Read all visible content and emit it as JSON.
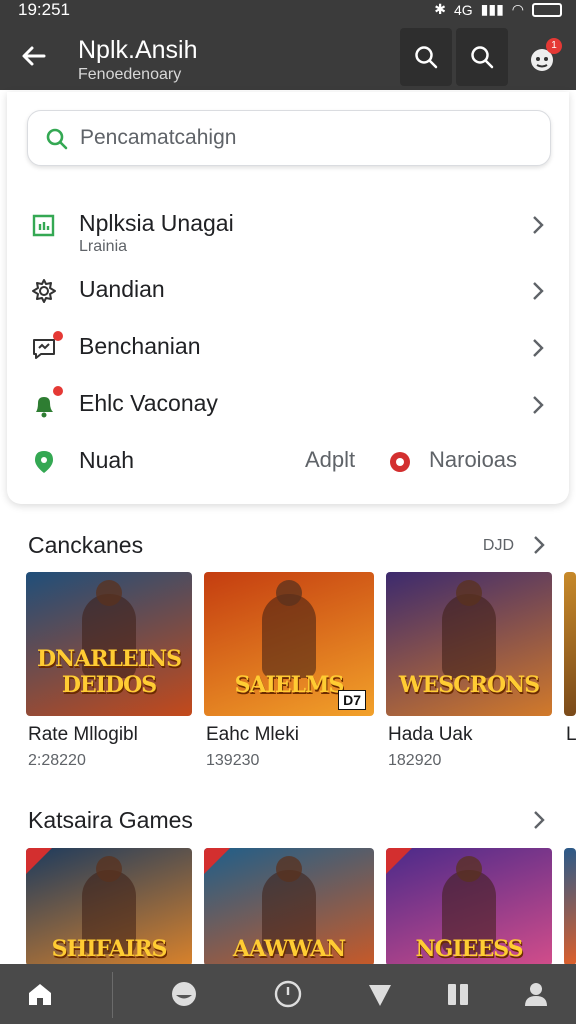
{
  "status_bar": {
    "time": "19:251",
    "net": "4G"
  },
  "app_bar": {
    "title": "Nplk.Ansih",
    "subtitle": "Fenoedenoary"
  },
  "search": {
    "placeholder": "Pencamatcahign"
  },
  "menu": {
    "items": [
      {
        "label": "Nplksia Unagai",
        "sub": "Lrainia"
      },
      {
        "label": "Uandian"
      },
      {
        "label": "Benchanian"
      },
      {
        "label": "Ehlc Vaconay"
      },
      {
        "label": "Nuah",
        "right_text_1": "Adplt",
        "right_text_2": "Naroioas"
      }
    ]
  },
  "section1": {
    "title": "Canckanes",
    "more": "DJD",
    "games": [
      {
        "name": "Rate Mllogibl",
        "count": "2:28220",
        "art": "DNARLEINS DEIDOS",
        "colors": [
          "#1f4e7a",
          "#c44a1b"
        ]
      },
      {
        "name": "Eahc Mleki",
        "count": "139230",
        "art": "SAIELMS",
        "colors": [
          "#c43d10",
          "#f2a12a"
        ],
        "badge": "D7"
      },
      {
        "name": "Hada Uak",
        "count": "182920",
        "art": "WESCRONS",
        "colors": [
          "#3c2a6e",
          "#d27a2a"
        ]
      },
      {
        "name": "L",
        "count": "",
        "art": "",
        "colors": [
          "#c88a2a",
          "#7a4a1a"
        ]
      }
    ]
  },
  "section2": {
    "title": "Katsaira Games",
    "games": [
      {
        "art": "SHIFAIRS",
        "colors": [
          "#1d3b5e",
          "#d9822b"
        ]
      },
      {
        "art": "AAWWAN",
        "colors": [
          "#1f5f8a",
          "#c85a28"
        ]
      },
      {
        "art": "NGIEESS",
        "colors": [
          "#4b2a8a",
          "#d24d8a"
        ]
      },
      {
        "art": "",
        "colors": [
          "#2a5a8a",
          "#e0602a"
        ]
      }
    ]
  },
  "colors": {
    "accent_green": "#34a853",
    "accent_red": "#e53935",
    "dark_bar": "#3b3b3b"
  }
}
